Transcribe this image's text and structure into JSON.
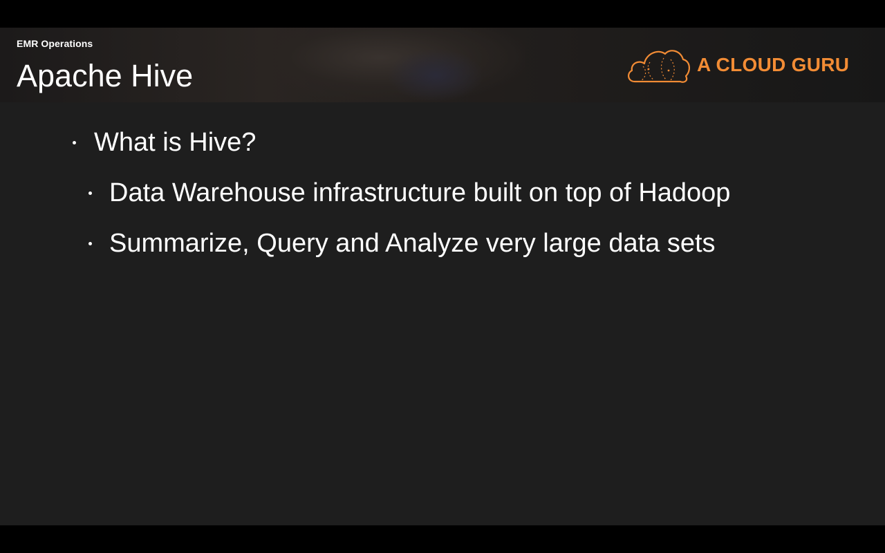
{
  "slide": {
    "section": "EMR Operations",
    "title": "Apache Hive",
    "logo_text": "A CLOUD GURU",
    "bullets": [
      {
        "level": 1,
        "text": "What is Hive?"
      },
      {
        "level": 2,
        "text": "Data Warehouse infrastructure built on top of Hadoop"
      },
      {
        "level": 2,
        "text": "Summarize, Query and Analyze very large data sets"
      }
    ]
  },
  "colors": {
    "background": "#1e1e1e",
    "letterbox": "#000000",
    "brand_orange": "#f28c35",
    "text": "#ffffff"
  },
  "icons": {
    "logo": "cloud-logo-icon",
    "bullet": "bullet-dot-icon"
  }
}
